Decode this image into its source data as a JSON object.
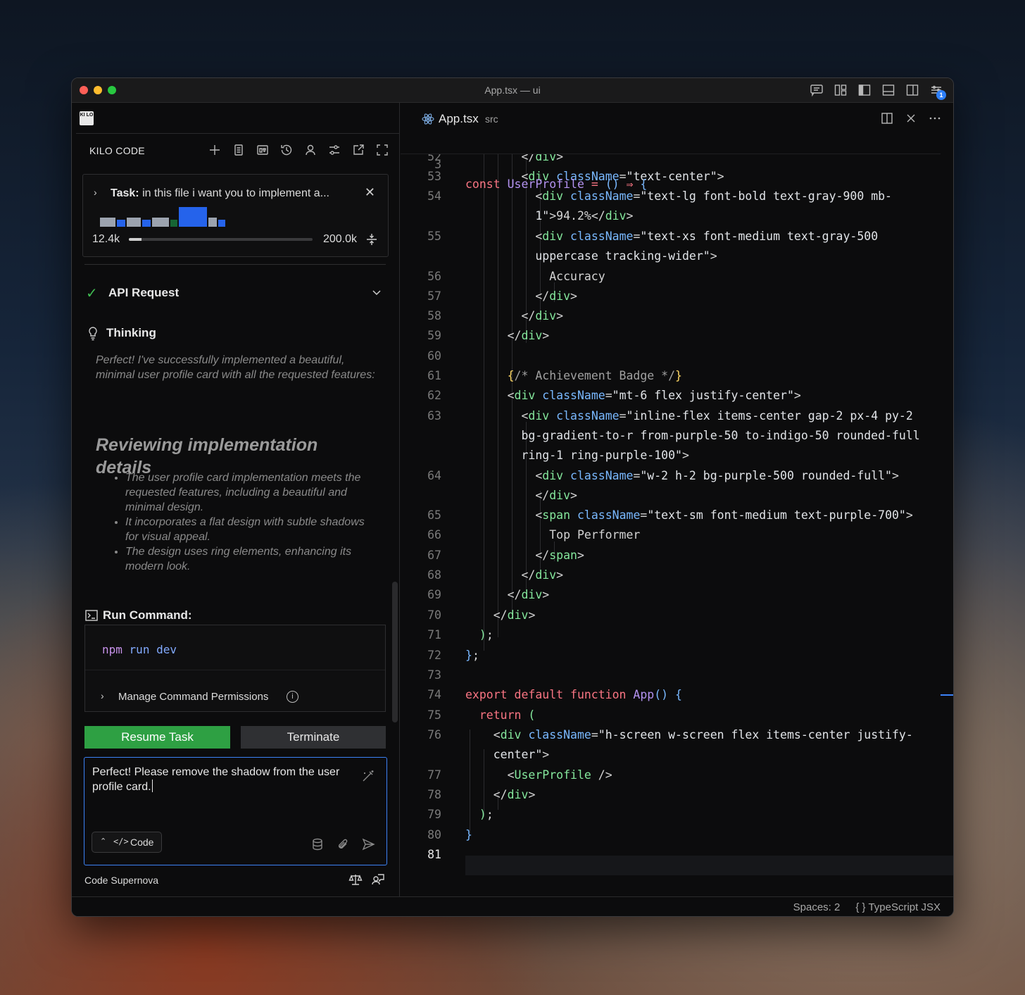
{
  "window": {
    "title": "App.tsx — ui",
    "notification_count": "1"
  },
  "kilo": {
    "logo_text": "KI LO",
    "title": "KILO CODE",
    "task": {
      "prefix": "Task:",
      "text": "in this file i want you to implement a...",
      "context_used": "12.4k",
      "context_max": "200.0k",
      "context_fraction": 0.062,
      "bars": [
        {
          "h": 0.45,
          "color": "#9ca3af"
        },
        {
          "h": 0.35,
          "color": "#2563eb"
        },
        {
          "h": 0.45,
          "color": "#9ca3af"
        },
        {
          "h": 0.35,
          "color": "#2563eb"
        },
        {
          "h": 0.45,
          "color": "#9ca3af"
        },
        {
          "h": 0.35,
          "color": "#166534"
        },
        {
          "h": 1.0,
          "color": "#2563eb"
        },
        {
          "h": 0.45,
          "color": "#9ca3af"
        },
        {
          "h": 0.35,
          "color": "#2563eb"
        }
      ]
    },
    "api_request": "API Request",
    "thinking": {
      "label": "Thinking",
      "body": "Perfect! I've successfully implemented a beautiful, minimal user profile card with all the requested features:",
      "heading": "Reviewing implementation details",
      "bullets": [
        "The user profile card implementation meets the requested features, including a beautiful and minimal design.",
        "It incorporates a flat design with subtle shadows for visual appeal.",
        "The design uses ring elements, enhancing its modern look."
      ]
    },
    "run_command": {
      "label": "Run Command:",
      "cmd_part1": "npm",
      "cmd_part2": "run dev",
      "permissions": "Manage Command Permissions"
    },
    "buttons": {
      "resume": "Resume Task",
      "terminate": "Terminate"
    },
    "input": {
      "value": "Perfect! Please remove the shadow from the user profile card.",
      "mode": "Code"
    },
    "model": "Code Supernova"
  },
  "editor": {
    "tab_name": "App.tsx",
    "tab_path": "src",
    "sticky_line": "3",
    "status": {
      "spaces": "Spaces: 2",
      "language": "TypeScript JSX"
    }
  }
}
